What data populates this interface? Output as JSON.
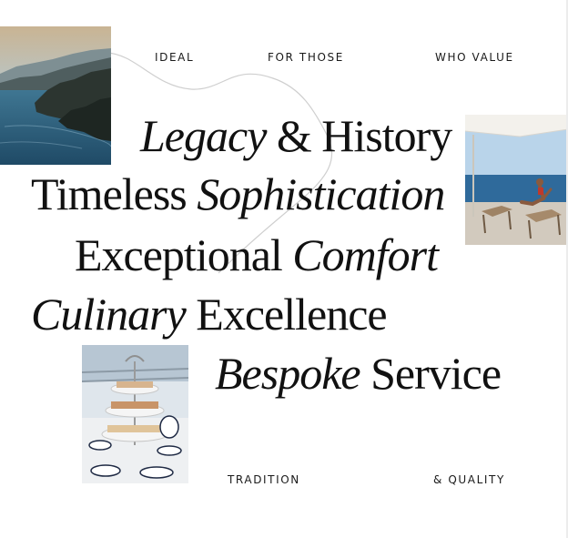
{
  "labels": {
    "ideal": "IDEAL",
    "for_those": "FOR THOSE",
    "who_value": "WHO VALUE",
    "tradition": "TRADITION",
    "quality": "& QUALITY"
  },
  "values": [
    {
      "italic": "Legacy",
      "plain": "& History"
    },
    {
      "plain": "Timeless",
      "italic": "Sophistication"
    },
    {
      "plain": "Exceptional",
      "italic": "Comfort"
    },
    {
      "italic": "Culinary",
      "plain": "Excellence"
    },
    {
      "italic": "Bespoke",
      "plain": "Service"
    }
  ],
  "colors": {
    "text": "#111111",
    "sea": "#2f5b78",
    "sky": "#bcd3e6"
  }
}
